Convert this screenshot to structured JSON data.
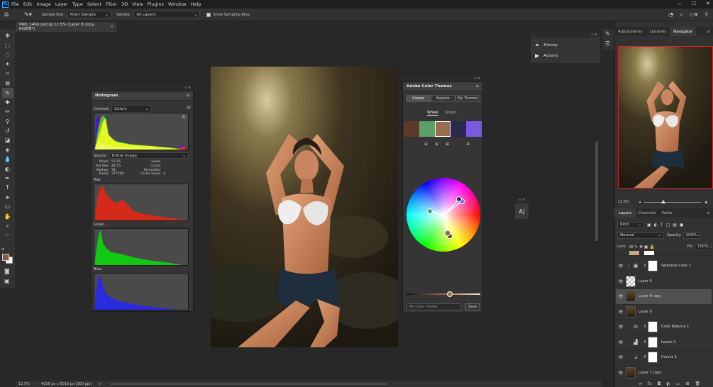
{
  "menubar": {
    "logo": "Ps",
    "items": [
      "File",
      "Edit",
      "Image",
      "Layer",
      "Type",
      "Select",
      "Filter",
      "3D",
      "View",
      "Plugins",
      "Window",
      "Help"
    ],
    "window_controls": [
      "—",
      "☐",
      "✕"
    ]
  },
  "options": {
    "sample_size_label": "Sample Size:",
    "sample_size_value": "Point Sample",
    "sample_label": "Sample:",
    "sample_value": "All Layers",
    "show_ring_label": "Show Sampling Ring"
  },
  "doc_tab": {
    "title": "PRO_1460.psd @ 12.5% (Layer 8 copy, RGB/8*)",
    "close": "×"
  },
  "histogram": {
    "title": "Histogram",
    "channel_label": "Channel:",
    "channel_value": "Colors",
    "source_label": "Source:",
    "source_value": "Entire Image",
    "stats_left": [
      {
        "k": "Mean:",
        "v": "57.05"
      },
      {
        "k": "Std Dev:",
        "v": "48.55"
      },
      {
        "k": "Median:",
        "v": "39"
      },
      {
        "k": "Pixels:",
        "v": "377504"
      }
    ],
    "stats_right": [
      {
        "k": "Level:",
        "v": ""
      },
      {
        "k": "Count:",
        "v": ""
      },
      {
        "k": "Percentile:",
        "v": ""
      },
      {
        "k": "Cache Level:",
        "v": "4"
      }
    ],
    "red_label": "Red",
    "green_label": "Green",
    "blue_label": "Blue"
  },
  "color_themes": {
    "title": "Adobe Color Themes",
    "tabs": [
      "Create",
      "Explore",
      "My Themes"
    ],
    "subtabs": [
      "Wheel",
      "Sliders"
    ],
    "swatches": [
      "#5a3a28",
      "#5aa06a",
      "#9a6c4e",
      "#2a2950",
      "#7a5be0"
    ],
    "name_placeholder": "My Color Theme",
    "save_label": "Save"
  },
  "history_panel": {
    "history": "History",
    "actions": "Actions"
  },
  "right_tabs": [
    "Adjustments",
    "Libraries",
    "Navigator"
  ],
  "navigator": {
    "zoom": "12.5%"
  },
  "layers_panel": {
    "tabs": [
      "Layers",
      "Channels",
      "Paths"
    ],
    "kind": "Kind",
    "blend": "Normal",
    "opacity_label": "Opacity:",
    "opacity_value": "100%",
    "lock_label": "Lock:",
    "fill_label": "Fill:",
    "fill_value": "100%",
    "layers": [
      {
        "name": "Selective Color 1",
        "type": "adjust",
        "icon": "selective-color"
      },
      {
        "name": "Layer 9",
        "type": "transparent"
      },
      {
        "name": "Layer 8 copy",
        "type": "photo",
        "selected": true
      },
      {
        "name": "Layer 8",
        "type": "photo"
      },
      {
        "name": "Color Balance 1",
        "type": "adjust",
        "icon": "color-balance"
      },
      {
        "name": "Levels 1",
        "type": "adjust",
        "icon": "levels"
      },
      {
        "name": "Curves 1",
        "type": "adjust",
        "icon": "curves"
      },
      {
        "name": "Layer 7 copy",
        "type": "photo"
      }
    ]
  },
  "status": {
    "zoom": "12.5%",
    "dims": "4016 px x 6016 px (300 ppi)",
    "arrow": ">"
  },
  "colors": {
    "foreground": "#8a5a3a",
    "background": "#ffffff",
    "accent": "#c0392b"
  }
}
